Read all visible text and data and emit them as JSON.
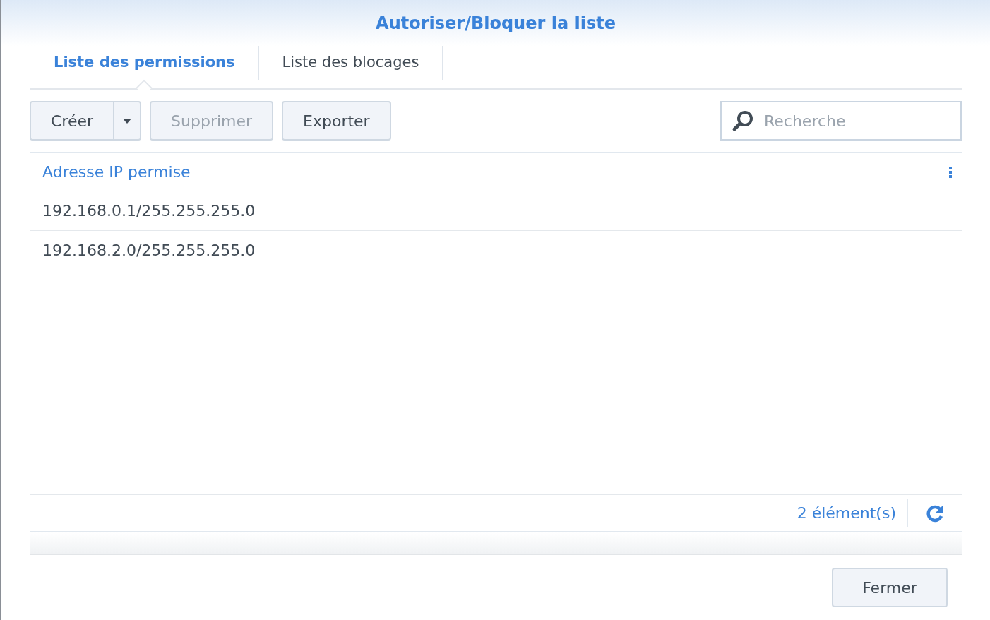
{
  "dialog": {
    "title": "Autoriser/Bloquer la liste"
  },
  "tabs": [
    {
      "label": "Liste des permissions",
      "selected": true
    },
    {
      "label": "Liste des blocages",
      "selected": false
    }
  ],
  "toolbar": {
    "buttons": [
      {
        "label": "Créer",
        "kind": "split",
        "disabled": false
      },
      {
        "label": "Supprimer",
        "kind": "plain",
        "disabled": true
      },
      {
        "label": "Exporter",
        "kind": "plain",
        "disabled": false
      }
    ],
    "search": {
      "placeholder": "Recherche"
    }
  },
  "table": {
    "columns": [
      "Adresse IP permise"
    ],
    "rows": [
      [
        "192.168.0.1/255.255.255.0"
      ],
      [
        "192.168.2.0/255.255.255.0"
      ]
    ]
  },
  "pager": {
    "count": "2 élément(s)"
  },
  "footer": {
    "buttons": [
      "Fermer"
    ]
  }
}
